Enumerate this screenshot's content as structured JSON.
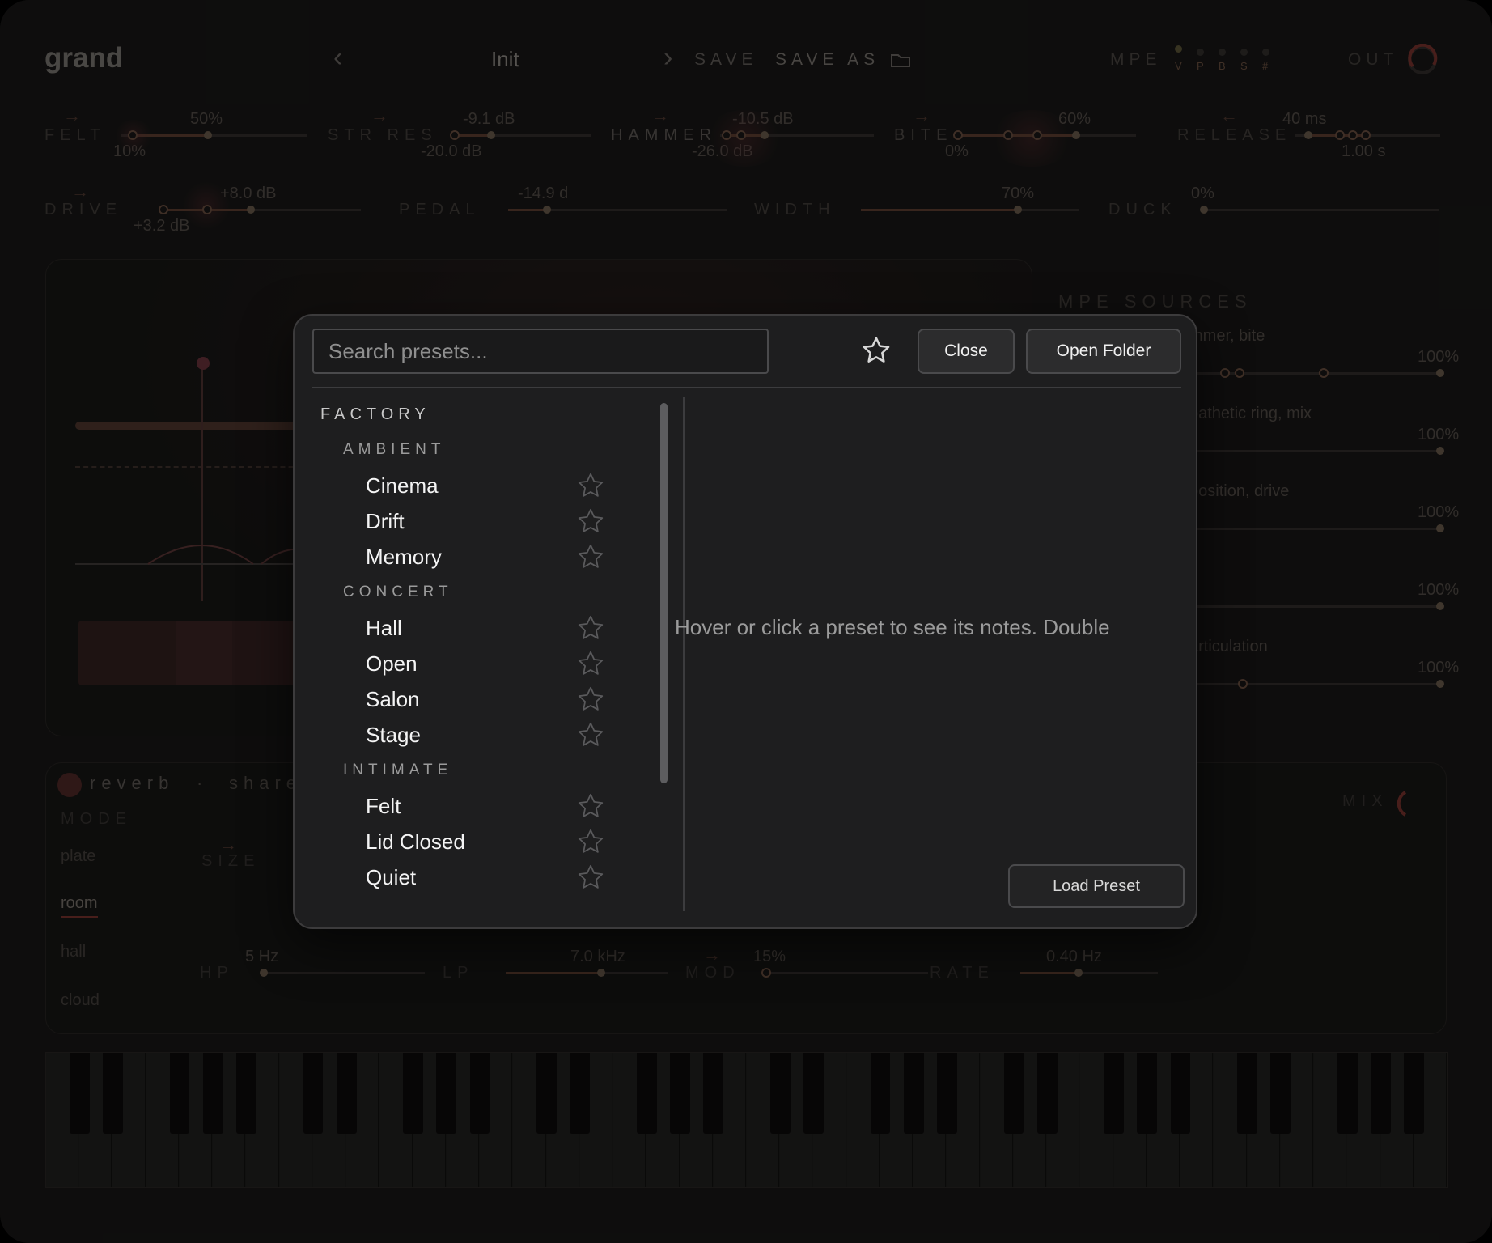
{
  "header": {
    "brand": "grand",
    "preset_name": "Init",
    "prev": "‹",
    "next": "›",
    "save": "SAVE",
    "save_as": "SAVE AS",
    "mpe": "MPE",
    "mpe_letters": [
      "V",
      "P",
      "B",
      "S",
      "#"
    ],
    "out": "OUT"
  },
  "params_row1": [
    {
      "label": "FELT",
      "val_top": "50%",
      "val_bot": "10%"
    },
    {
      "label": "STR RES",
      "val_top": "-9.1 dB",
      "val_bot": "-20.0 dB"
    },
    {
      "label": "HAMMER",
      "val_top": "-10.5 dB",
      "val_bot": "-26.0 dB"
    },
    {
      "label": "BITE",
      "val_top": "60%",
      "val_bot": "0%"
    },
    {
      "label": "RELEASE",
      "val_top": "40 ms",
      "val_bot": "1.00 s"
    }
  ],
  "params_row2": [
    {
      "label": "DRIVE",
      "val_top": "+8.0 dB",
      "val_bot": "+3.2 dB"
    },
    {
      "label": "PEDAL",
      "val_top": "-14.9 d"
    },
    {
      "label": "WIDTH",
      "val_top": "70%"
    },
    {
      "label": "DUCK",
      "val_top": "0%"
    }
  ],
  "mpe_sources": {
    "title": "MPE SOURCES",
    "rows": [
      {
        "desc": "mmer, bite",
        "value": "100%"
      },
      {
        "desc": "pathetic ring, mix",
        "value": "100%"
      },
      {
        "desc": "position, drive",
        "value": "100%"
      },
      {
        "desc": "",
        "value": "100%"
      },
      {
        "desc": "articulation",
        "value": "100%"
      }
    ]
  },
  "reverb": {
    "title": "reverb",
    "dot": "·",
    "share": "share",
    "mode_label": "MODE",
    "modes": [
      "plate",
      "room",
      "hall",
      "cloud"
    ],
    "size_label": "SIZE",
    "mix_label": "MIX",
    "hp_label": "HP",
    "hp_val": "5 Hz",
    "lp_label": "LP",
    "lp_val": "7.0 kHz",
    "mod_label": "MOD",
    "mod_val": "15%",
    "rate_label": "RATE",
    "rate_val": "0.40 Hz"
  },
  "browser": {
    "search_placeholder": "Search presets...",
    "close": "Close",
    "open_folder": "Open Folder",
    "category": "FACTORY",
    "groups": [
      {
        "name": "AMBIENT",
        "items": [
          "Cinema",
          "Drift",
          "Memory"
        ]
      },
      {
        "name": "CONCERT",
        "items": [
          "Hall",
          "Open",
          "Salon",
          "Stage"
        ]
      },
      {
        "name": "INTIMATE",
        "items": [
          "Felt",
          "Lid Closed",
          "Quiet"
        ]
      },
      {
        "name": "POP",
        "items": []
      }
    ],
    "notes": "Hover or click a preset to see its notes. Double",
    "load": "Load Preset"
  },
  "colors": {
    "accent": "#c9574a",
    "modal_bg": "#1e1e1f"
  }
}
